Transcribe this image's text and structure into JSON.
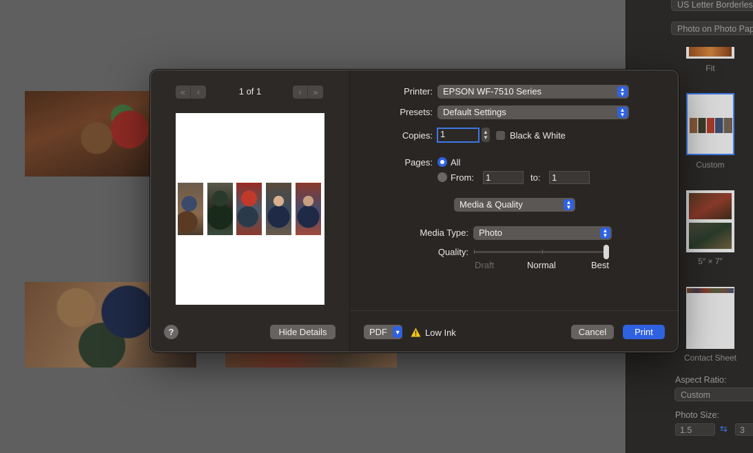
{
  "background": {
    "right_panel": {
      "paper_popup": "US Letter Borderless",
      "type_popup": "Photo on Photo Paper",
      "layouts": [
        {
          "caption": "Fit"
        },
        {
          "caption": "Custom"
        },
        {
          "caption": "5″ × 7″"
        },
        {
          "caption": "Contact Sheet"
        }
      ],
      "aspect_ratio_label": "Aspect Ratio:",
      "aspect_ratio_value": "Custom",
      "photo_size_label": "Photo Size:",
      "photo_width": "1.5",
      "photo_height": "3"
    }
  },
  "dialog": {
    "preview": {
      "page_indicator": "1 of 1",
      "nav_first": "«",
      "nav_prev": "‹",
      "nav_next": "›",
      "nav_last": "»",
      "photo_count": 5
    },
    "help_label": "?",
    "hide_details_label": "Hide Details",
    "printer": {
      "label": "Printer:",
      "value": "EPSON WF-7510 Series"
    },
    "presets": {
      "label": "Presets:",
      "value": "Default Settings"
    },
    "copies": {
      "label": "Copies:",
      "value": "1",
      "black_white_label": "Black & White",
      "black_white_checked": false
    },
    "pages": {
      "label": "Pages:",
      "all_label": "All",
      "all_selected": true,
      "from_label": "From:",
      "from_value": "1",
      "to_label": "to:",
      "to_value": "1"
    },
    "section_popup": "Media & Quality",
    "media_type": {
      "label": "Media Type:",
      "value": "Photo"
    },
    "quality": {
      "label": "Quality:",
      "levels": [
        "Draft",
        "Normal",
        "Best"
      ],
      "selected": "Best",
      "position": 1.0
    },
    "footer": {
      "pdf_label": "PDF",
      "warning_text": "Low Ink",
      "cancel_label": "Cancel",
      "print_label": "Print"
    }
  },
  "colors": {
    "accent": "#2f62e0",
    "dialog_bg": "#2d2927",
    "warning": "#f5c518"
  }
}
